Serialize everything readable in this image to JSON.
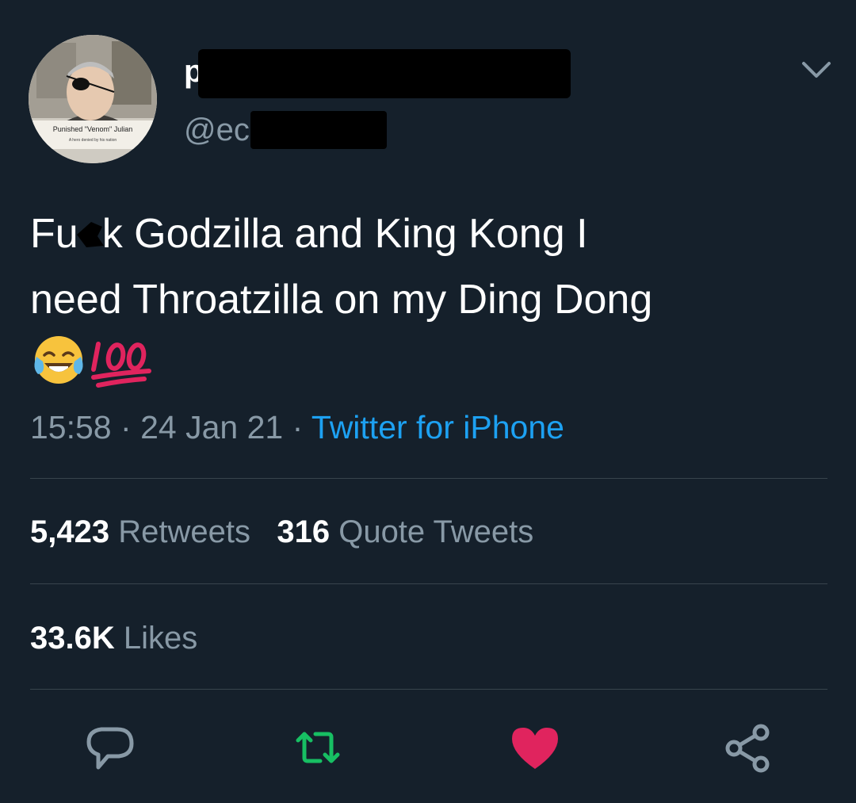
{
  "user": {
    "display_name": "pu",
    "handle": "@ec",
    "avatar_caption": "Punished \"Venom\" Julian",
    "avatar_subcaption": "A hero denied by his nation"
  },
  "tweet": {
    "text_line1_start": "Fu",
    "text_line1_end": "k Godzilla and King Kong I",
    "text_line2": "need Throatzilla on my Ding Dong",
    "emojis": [
      "face-with-tears-of-joy",
      "hundred-points"
    ],
    "time": "15:58",
    "separator": "·",
    "date": "24 Jan 21",
    "source": "Twitter for iPhone"
  },
  "stats": {
    "retweets_count": "5,423",
    "retweets_label": "Retweets",
    "quotes_count": "316",
    "quotes_label": "Quote Tweets",
    "likes_count": "33.6K",
    "likes_label": "Likes"
  },
  "actions": [
    "reply-icon",
    "retweet-icon",
    "like-icon",
    "share-icon"
  ],
  "colors": {
    "background": "#15202b",
    "text": "#ffffff",
    "secondary": "#8899a6",
    "link": "#1da1f2",
    "divider": "#38444d",
    "retweet_green": "#17bf63",
    "like_red": "#e0245e"
  }
}
